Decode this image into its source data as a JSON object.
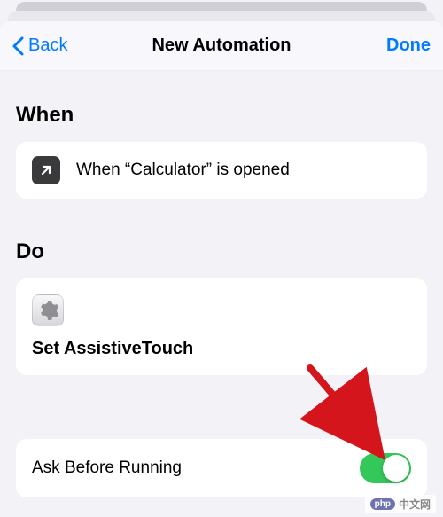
{
  "nav": {
    "back_label": "Back",
    "title": "New Automation",
    "done_label": "Done"
  },
  "sections": {
    "when_header": "When",
    "when_text": "When “Calculator” is opened",
    "do_header": "Do",
    "do_text": "Set AssistiveTouch",
    "ask_label": "Ask Before Running"
  },
  "toggle": {
    "ask_before_running": true
  },
  "watermark": {
    "badge": "php",
    "text": "中文网"
  }
}
